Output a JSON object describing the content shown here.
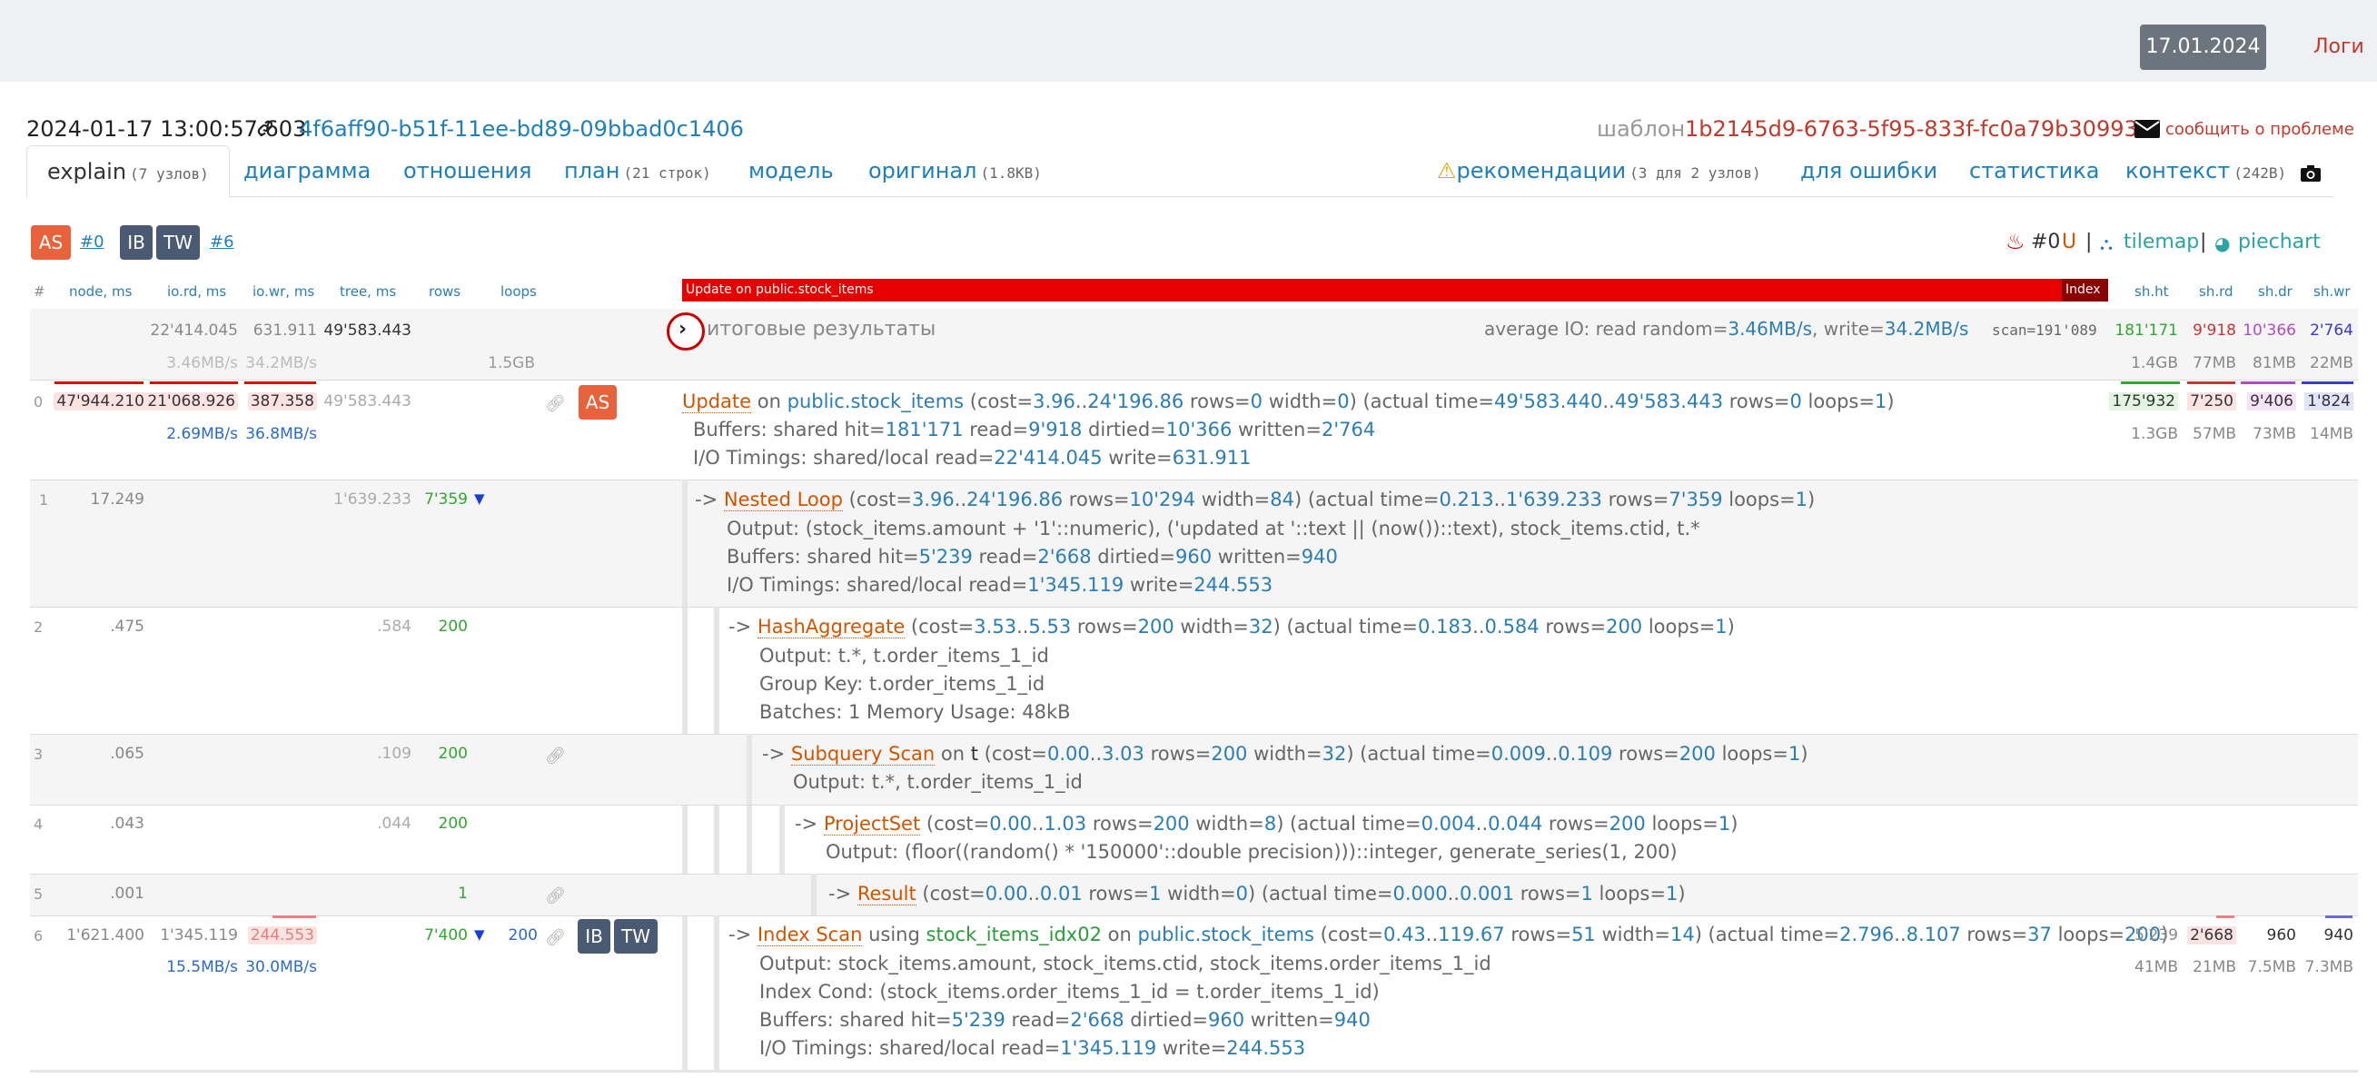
{
  "topbar": {
    "date": "17.01.2024",
    "logs": "Логи"
  },
  "header": {
    "timestamp": "2024-01-17 13:00:57.603",
    "plan_id": "4f6aff90-b51f-11ee-bd89-09bbad0c1406",
    "template_label": "шаблон",
    "template_id": "1b2145d9-6763-5f95-833f-fc0a79b30993",
    "report": "сообщить о проблеме"
  },
  "tabs": {
    "explain": "explain",
    "explain_count": "(7 узлов)",
    "diagram": "диаграмма",
    "relations": "отношения",
    "plan": "план",
    "plan_count": "(21 строк)",
    "model": "модель",
    "original": "оригинал",
    "original_size": "(1.8KB)",
    "recommendations": "рекомендации",
    "recommendations_count": "(3 для 2 узлов)",
    "for_error": "для ошибки",
    "statistics": "статистика",
    "context": "контекст",
    "context_size": "(242B)"
  },
  "badges": {
    "as": "AS",
    "as_ref": "#0",
    "ib": "IB",
    "tw": "TW",
    "ibtw_ref": "#6"
  },
  "right_tools": {
    "ref": "#0",
    "u": "U",
    "sep": "|",
    "tilemap": "tilemap",
    "piechart": "piechart"
  },
  "columns": {
    "num": "#",
    "node": "node, ms",
    "iord": "io.rd, ms",
    "iowr": "io.wr, ms",
    "tree": "tree, ms",
    "rows": "rows",
    "loops": "loops",
    "shht": "sh.ht",
    "shrd": "sh.rd",
    "shdr": "sh.dr",
    "shwr": "sh.wr"
  },
  "timeline": {
    "label": "Update on public.stock_items",
    "index_label": "Index"
  },
  "summary": {
    "iord": "22'414.045",
    "iowr": "631.911",
    "tree": "49'583.443",
    "iord_rate": "3.46MB/s",
    "iowr_rate": "34.2MB/s",
    "title": "итоговые результаты",
    "avg_io": "average IO: read random=",
    "avg_read": "3.46MB/s",
    "avg_write_label": ", write=",
    "avg_write": "34.2MB/s",
    "scan": "scan=191'089",
    "scan_size": "1.5GB",
    "shht": "181'171",
    "shrd": "9'918",
    "shdr": "10'366",
    "shwr": "2'764",
    "shht_sz": "1.4GB",
    "shrd_sz": "77MB",
    "shdr_sz": "81MB",
    "shwr_sz": "22MB"
  },
  "nodes": [
    {
      "num": "0",
      "node": "47'944.210",
      "iord": "21'068.926",
      "iowr": "387.358",
      "tree": "49'583.443",
      "iord_rate": "2.69MB/s",
      "iowr_rate": "36.8MB/s",
      "badge": "AS",
      "name": "Update",
      "on": "on",
      "rel": "public.stock_items",
      "cost_a": "3.96",
      "cost_b": "24'196.86",
      "rows_est": "0",
      "width": "0",
      "at_a": "49'583.440",
      "at_b": "49'583.443",
      "rows": "0",
      "loops": "1",
      "line2_a": "Buffers: shared hit=",
      "hit": "181'171",
      "read_l": " read=",
      "read": "9'918",
      "dirt_l": " dirtied=",
      "dirt": "10'366",
      "wr_l": " written=",
      "wr": "2'764",
      "line3_a": "I/O Timings: shared/local read=",
      "ior": "22'414.045",
      "iow_l": " write=",
      "iow": "631.911",
      "shht": "175'932",
      "shrd": "7'250",
      "shdr": "9'406",
      "shwr": "1'824",
      "shht_sz": "1.3GB",
      "shrd_sz": "57MB",
      "shdr_sz": "73MB",
      "shwr_sz": "14MB"
    },
    {
      "num": "1",
      "node": "17.249",
      "tree": "1'639.233",
      "rows_cell": "7'359",
      "name": "Nested Loop",
      "cost_a": "3.96",
      "cost_b": "24'196.86",
      "rows_est": "10'294",
      "width": "84",
      "at_a": "0.213",
      "at_b": "1'639.233",
      "rows": "7'359",
      "loops": "1",
      "output": "Output: (stock_items.amount + '1'::numeric), ('updated at '::text || (now())::text), stock_items.ctid, t.*",
      "line2_a": "Buffers: shared hit=",
      "hit": "5'239",
      "read_l": " read=",
      "read": "2'668",
      "dirt_l": " dirtied=",
      "dirt": "960",
      "wr_l": " written=",
      "wr": "940",
      "line3_a": "I/O Timings: shared/local read=",
      "ior": "1'345.119",
      "iow_l": " write=",
      "iow": "244.553"
    },
    {
      "num": "2",
      "node": ".475",
      "tree": ".584",
      "rows_cell": "200",
      "name": "HashAggregate",
      "cost_a": "3.53",
      "cost_b": "5.53",
      "rows_est": "200",
      "width": "32",
      "at_a": "0.183",
      "at_b": "0.584",
      "rows": "200",
      "loops": "1",
      "output": "Output: t.*, t.order_items_1_id",
      "group_key": "Group Key: t.order_items_1_id",
      "batches": "Batches: 1  Memory Usage: 48kB"
    },
    {
      "num": "3",
      "node": ".065",
      "tree": ".109",
      "rows_cell": "200",
      "name": "Subquery Scan",
      "on": "on",
      "rel": "t",
      "cost_a": "0.00",
      "cost_b": "3.03",
      "rows_est": "200",
      "width": "32",
      "at_a": "0.009",
      "at_b": "0.109",
      "rows": "200",
      "loops": "1",
      "output": "Output: t.*, t.order_items_1_id"
    },
    {
      "num": "4",
      "node": ".043",
      "tree": ".044",
      "rows_cell": "200",
      "name": "ProjectSet",
      "cost_a": "0.00",
      "cost_b": "1.03",
      "rows_est": "200",
      "width": "8",
      "at_a": "0.004",
      "at_b": "0.044",
      "rows": "200",
      "loops": "1",
      "output": "Output: (floor((random() * '150000'::double precision)))::integer, generate_series(1, 200)"
    },
    {
      "num": "5",
      "node": ".001",
      "rows_cell": "1",
      "name": "Result",
      "cost_a": "0.00",
      "cost_b": "0.01",
      "rows_est": "1",
      "width": "0",
      "at_a": "0.000",
      "at_b": "0.001",
      "rows": "1",
      "loops": "1"
    },
    {
      "num": "6",
      "node": "1'621.400",
      "iord": "1'345.119",
      "iowr": "244.553",
      "rows_cell": "7'400",
      "loops_cell": "200",
      "iord_rate": "15.5MB/s",
      "iowr_rate": "30.0MB/s",
      "name": "Index Scan",
      "using": "using",
      "idx": "stock_items_idx02",
      "on": "on",
      "rel": "public.stock_items",
      "cost_a": "0.43",
      "cost_b": "119.67",
      "rows_est": "51",
      "width": "14",
      "at_a": "2.796",
      "at_b": "8.107",
      "rows": "37",
      "loops": "200",
      "output": "Output: stock_items.amount, stock_items.ctid, stock_items.order_items_1_id",
      "cond": "Index Cond: (stock_items.order_items_1_id = t.order_items_1_id)",
      "line2_a": "Buffers: shared hit=",
      "hit": "5'239",
      "read_l": " read=",
      "read": "2'668",
      "dirt_l": " dirtied=",
      "dirt": "960",
      "wr_l": " written=",
      "wr": "940",
      "line3_a": "I/O Timings: shared/local read=",
      "ior": "1'345.119",
      "iow_l": " write=",
      "iow": "244.553",
      "shht": "5'239",
      "shrd": "2'668",
      "shdr": "960",
      "shwr": "940",
      "shht_sz": "41MB",
      "shrd_sz": "21MB",
      "shdr_sz": "7.5MB",
      "shwr_sz": "7.3MB"
    }
  ]
}
